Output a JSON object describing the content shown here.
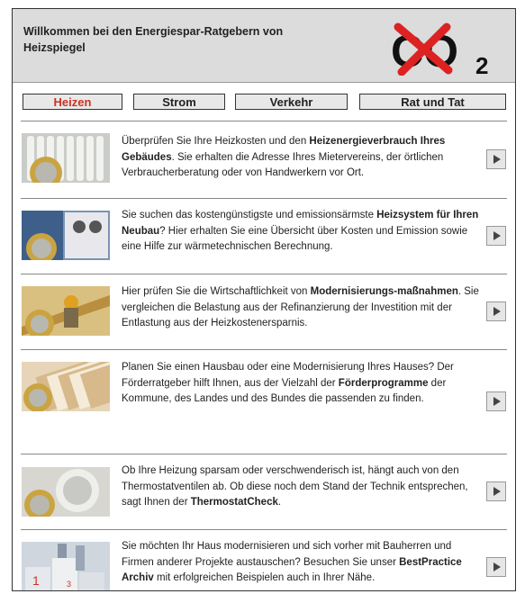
{
  "header": {
    "title": "Willkommen bei den Energiespar-Ratgebern von Heizspiegel",
    "logo_text": "CO",
    "logo_subscript": "2"
  },
  "tabs": [
    {
      "label": "Heizen",
      "active": true
    },
    {
      "label": "Strom",
      "active": false
    },
    {
      "label": "Verkehr",
      "active": false
    },
    {
      "label": "Rat und Tat",
      "active": false
    }
  ],
  "rows": [
    {
      "thumb": "radiator-coin-image",
      "parts": [
        {
          "t": "Überprüfen Sie Ihre Heizkosten und den ",
          "b": false
        },
        {
          "t": "Heizenergieverbrauch Ihres Gebäudes",
          "b": true
        },
        {
          "t": ". Sie erhalten die Adresse Ihres Mietervereins, der örtlichen Verbraucherberatung oder von Handwerkern vor Ort.",
          "b": false
        }
      ]
    },
    {
      "thumb": "boiler-coin-image",
      "parts": [
        {
          "t": "Sie suchen das kostengünstigste und emissionsärmste ",
          "b": false
        },
        {
          "t": "Heizsystem für Ihren Neubau",
          "b": true
        },
        {
          "t": "? Hier erhalten Sie eine Übersicht über Kosten und Emission sowie eine Hilfe zur wärmetechnischen Berechnung.",
          "b": false
        }
      ]
    },
    {
      "thumb": "construction-worker-image",
      "parts": [
        {
          "t": "Hier prüfen Sie die Wirtschaftlichkeit von ",
          "b": false
        },
        {
          "t": "Modernisierungs-maßnahmen",
          "b": true
        },
        {
          "t": ". Sie vergleichen die Belastung aus der Refinanzierung der Investition mit der Entlastung aus der Heizkostenersparnis.",
          "b": false
        }
      ]
    },
    {
      "thumb": "documents-coin-image",
      "parts": [
        {
          "t": "Planen Sie einen Hausbau oder eine Modernisierung Ihres Hauses? Der Förderratgeber hilft Ihnen, aus der Vielzahl der ",
          "b": false
        },
        {
          "t": "Förderprogramme",
          "b": true
        },
        {
          "t": " der Kommune, des Landes und des Bundes die passenden zu finden.",
          "b": false
        }
      ]
    },
    {
      "thumb": "thermostat-coin-image",
      "parts": [
        {
          "t": "Ob Ihre Heizung sparsam oder verschwenderisch ist, hängt auch von den Thermostatventilen ab. Ob diese noch dem Stand der Technik entsprechen, sagt Ihnen der ",
          "b": false
        },
        {
          "t": "ThermostatCheck",
          "b": true
        },
        {
          "t": ".",
          "b": false
        }
      ]
    },
    {
      "thumb": "podium-image",
      "parts": [
        {
          "t": "Sie möchten Ihr Haus modernisieren und sich vorher mit Bauherren und Firmen anderer Projekte austauschen? Besuchen Sie unser ",
          "b": false
        },
        {
          "t": "BestPractice Archiv",
          "b": true
        },
        {
          "t": " mit erfolgreichen Beispielen auch in Ihrer Nähe.",
          "b": false
        }
      ]
    }
  ],
  "arrow_icon": "play-arrow-icon",
  "colors": {
    "active_tab": "#cc3322",
    "header_bg": "#dcdcdc",
    "logo_cross": "#dd2222"
  }
}
